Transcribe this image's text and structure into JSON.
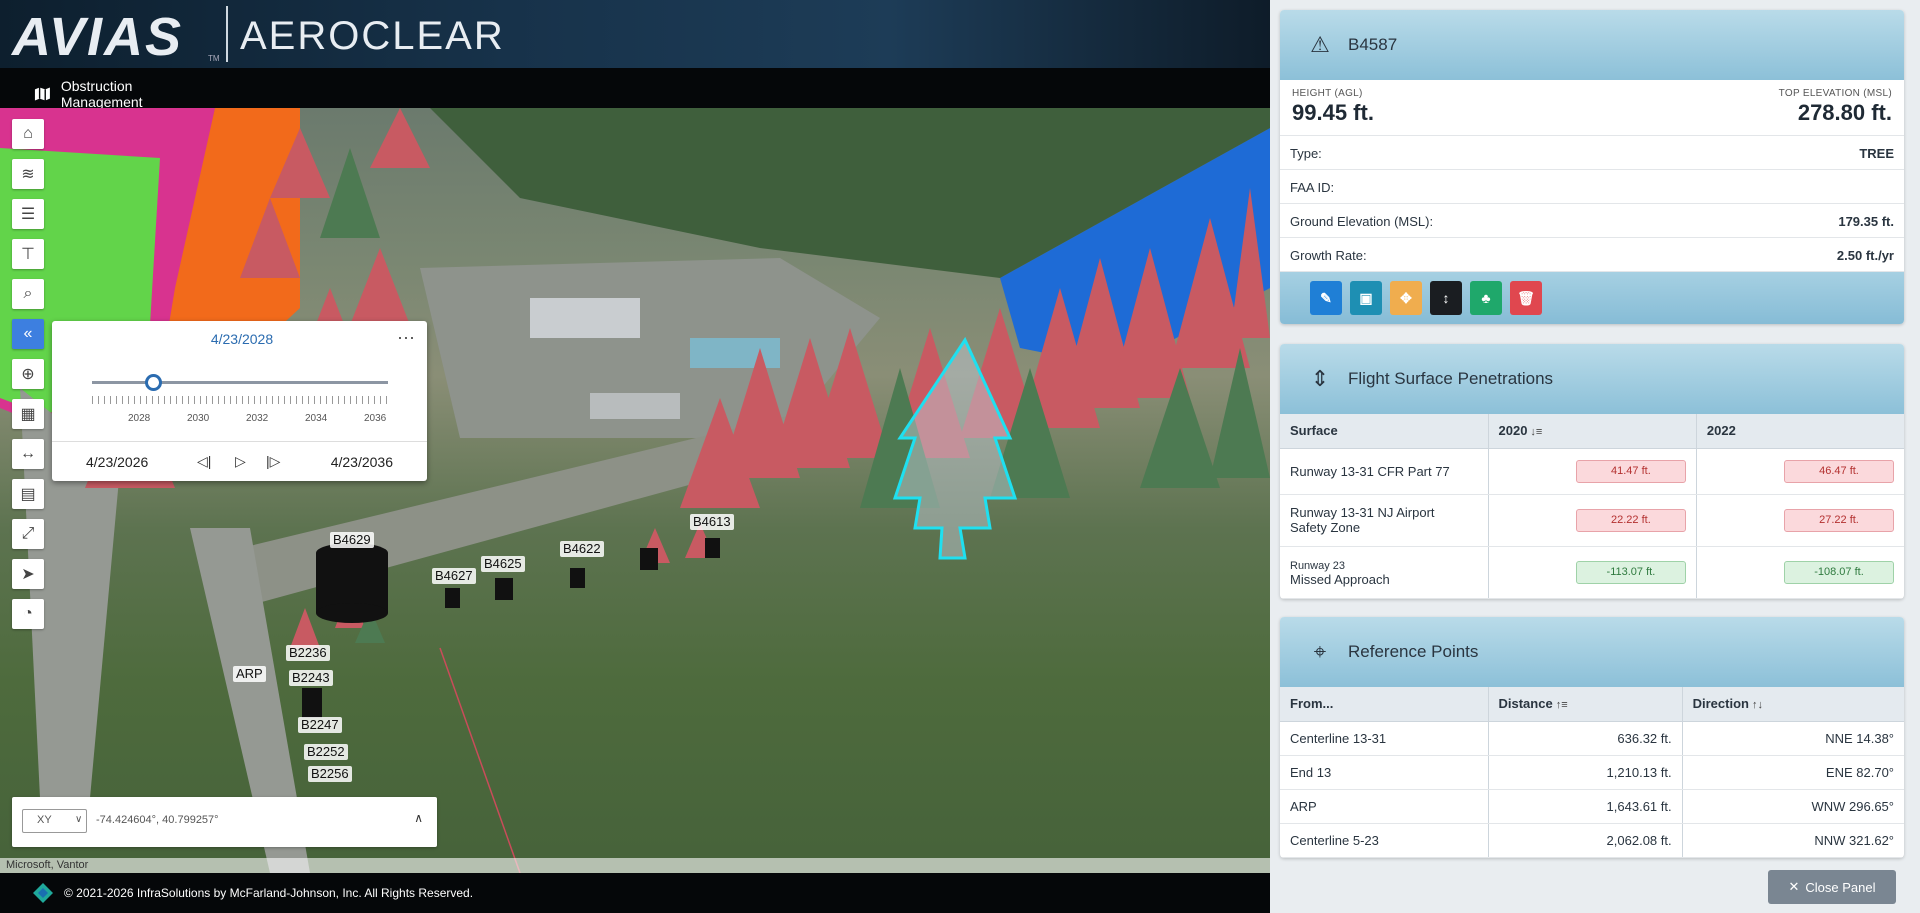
{
  "header": {
    "logo_primary": "AVIAS",
    "logo_tm": "TM",
    "logo_secondary": "AEROCLEAR",
    "nav_tab": "Obstruction Management"
  },
  "map": {
    "attribution": "Microsoft, Vantor",
    "labels": [
      {
        "text": "B4629"
      },
      {
        "text": "B4627"
      },
      {
        "text": "B4625"
      },
      {
        "text": "B4622"
      },
      {
        "text": "B4613"
      },
      {
        "text": "B2236"
      },
      {
        "text": "B2243"
      },
      {
        "text": "ARP"
      },
      {
        "text": "B2247"
      },
      {
        "text": "B2252"
      },
      {
        "text": "B2256"
      }
    ],
    "colors": {
      "pink_surface": "#d8338f",
      "green_surface": "#62d44a",
      "orange_surface": "#f26a1b",
      "blue_surface": "#1e6bd6",
      "tree_red": "#c85a62",
      "tree_green": "#4d7a52",
      "highlight": "#1fe0f0"
    }
  },
  "toolbar": {
    "icons": [
      "home-icon",
      "layers-icon",
      "list-icon",
      "filter-icon",
      "search-map-icon",
      "collapse-icon",
      "add-point-icon",
      "grid-icon",
      "measure-icon",
      "report-icon",
      "fullscreen-icon",
      "compass-icon",
      "globe-icon"
    ]
  },
  "timeslider": {
    "current_date": "4/23/2028",
    "start_date": "4/23/2026",
    "end_date": "4/23/2036",
    "years": [
      "2028",
      "2030",
      "2032",
      "2034",
      "2036"
    ],
    "more": "···",
    "progress": 0.2
  },
  "coords": {
    "mode": "XY",
    "value": "-74.424604°, 40.799257°"
  },
  "footer": {
    "copyright": "© 2021-2026 InfraSolutions by McFarland-Johnson, Inc. All Rights Reserved."
  },
  "detail": {
    "title": "B4587",
    "height_label": "HEIGHT (AGL)",
    "height_value": "99.45 ft.",
    "top_label": "TOP ELEVATION (MSL)",
    "top_value": "278.80 ft.",
    "rows": [
      {
        "k": "Type:",
        "v": "TREE"
      },
      {
        "k": "FAA ID:",
        "v": ""
      },
      {
        "k": "Ground Elevation (MSL):",
        "v": "179.35 ft."
      },
      {
        "k": "Growth Rate:",
        "v": "2.50 ft./yr"
      }
    ],
    "actions": [
      {
        "name": "edit-icon",
        "color": "#1f7fd6"
      },
      {
        "name": "document-icon",
        "color": "#1e8fb3"
      },
      {
        "name": "move-icon",
        "color": "#f0ad4e"
      },
      {
        "name": "height-icon",
        "color": "#1a1d21"
      },
      {
        "name": "trees-icon",
        "color": "#1fa86b"
      },
      {
        "name": "trash-icon",
        "color": "#e0474f"
      }
    ]
  },
  "penetrations": {
    "title": "Flight Surface Penetrations",
    "columns": [
      "Surface",
      "2020",
      "2022"
    ],
    "rows": [
      {
        "surface": "Runway 13-31 CFR Part 77",
        "sub": "",
        "a": "41.47 ft.",
        "b": "46.47 ft.",
        "status": "red"
      },
      {
        "surface": "Runway 13-31 NJ Airport",
        "sub": "Safety Zone",
        "a": "22.22 ft.",
        "b": "27.22 ft.",
        "status": "red"
      },
      {
        "surface": "Runway 23",
        "sub": "Missed Approach",
        "a": "-113.07 ft.",
        "b": "-108.07 ft.",
        "status": "green"
      }
    ]
  },
  "reference": {
    "title": "Reference Points",
    "columns": [
      "From...",
      "Distance",
      "Direction"
    ],
    "rows": [
      {
        "from": "Centerline 13-31",
        "distance": "636.32 ft.",
        "direction": "NNE 14.38°"
      },
      {
        "from": "End 13",
        "distance": "1,210.13 ft.",
        "direction": "ENE 82.70°"
      },
      {
        "from": "ARP",
        "distance": "1,643.61 ft.",
        "direction": "WNW 296.65°"
      },
      {
        "from": "Centerline 5-23",
        "distance": "2,062.08 ft.",
        "direction": "NNW 321.62°"
      }
    ]
  },
  "close_label": "Close Panel"
}
